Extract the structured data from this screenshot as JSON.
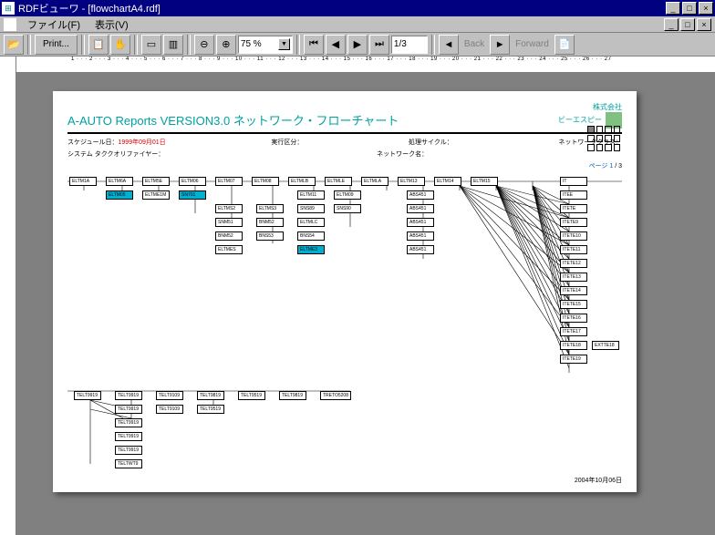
{
  "window": {
    "title": "RDFビューワ - [flowchartA4.rdf]",
    "min": "_",
    "max": "□",
    "close": "×"
  },
  "menu": {
    "file": "ファイル(F)",
    "view": "表示(V)"
  },
  "toolbar": {
    "print": "Print...",
    "zoom": "75 %",
    "page": "1/3",
    "back": "Back",
    "forward": "Forward"
  },
  "ruler_h": "1 · · · 2 · · · 3 · · · 4 · · · 5 · · · 6 · · · 7 · · · 8 · · · 9 · · · 10 · · · 11 · · · 12 · · · 13 · · · 14 · · · 15 · · · 16 · · · 17 · · · 18 · · · 19 · · · 20 · · · 21 · · · 22 · · · 23 · · · 24 · · · 25 · · · 26 · · · 27",
  "doc": {
    "title": "A-AUTO Reports VERSION3.0 ネットワーク・フローチャート",
    "company1": "株式会社",
    "company2": "ビーエスピー",
    "schedule_label": "スケジュール日：",
    "schedule_value": "1999年09月01日",
    "exec_label": "実行区分：",
    "cycle_label": "処理サイクル：",
    "class_label": "ネットワーククラス：",
    "system_label": "システム タククオリファイヤー：",
    "network_label": "ネットワーク名：",
    "page_info_a": "ページ 1",
    "page_info_b": " / 3",
    "footer_date": "2004年10月06日"
  },
  "nodes": {
    "r1": [
      "ELTM1A",
      "ELTM6A",
      "ELTM5E",
      "ELTM06",
      "ELTM07",
      "ELTM08",
      "ELTMLB",
      "ELTMLE",
      "ELTMLA",
      "ELTM13",
      "ELTM14",
      "ELTM15",
      "IT"
    ],
    "r2a": "ELTM05",
    "r2b": "ELTME1M",
    "r2c": "SN701",
    "r2d": "ELTMS2",
    "r2e": "ELTMS3",
    "r2f": "ELTM11",
    "r2g": "ELTM09",
    "r2h": "ABS451",
    "r2i": "ITEE",
    "r3a": "SNM51",
    "r3b": "BNM52",
    "r3c": "SNS89",
    "r3d": "SNS90",
    "r3e": "ELTMLC",
    "r3f": "ABS451",
    "r3g": "ITETE",
    "r4a": "BNM52",
    "r4b": "BNS53",
    "r4c": "BNS54",
    "r4d": "ABS451",
    "r4e": "ABS451",
    "r4f": "ITETE9",
    "r5a": "ELTMES",
    "r5b": "ELTME3",
    "r5c": "ABS451",
    "r5d": "ITETE10",
    "r6a": "ITETE11",
    "r7a": "ITETE12",
    "r8a": "ITETE13",
    "r9a": "ITETE14",
    "r10a": "ITETE15",
    "r11a": "ITETE16",
    "r12a": "ITETE17",
    "r13a": "ITETE18",
    "r13b": "EXTTE18",
    "r14a": "ITETE19",
    "b1": [
      "TELT9919",
      "TELT9919",
      "TELT9109",
      "TELT9819",
      "TELT9519",
      "TELT9819",
      "TRETO5208"
    ],
    "b2a": "TELT9919",
    "b2b": "TELT9109",
    "b2c": "TELT9519",
    "b3a": "TELT9919",
    "b4a": "TELT9919",
    "b5a": "TELT9919",
    "b6a": "TELTWT9"
  }
}
